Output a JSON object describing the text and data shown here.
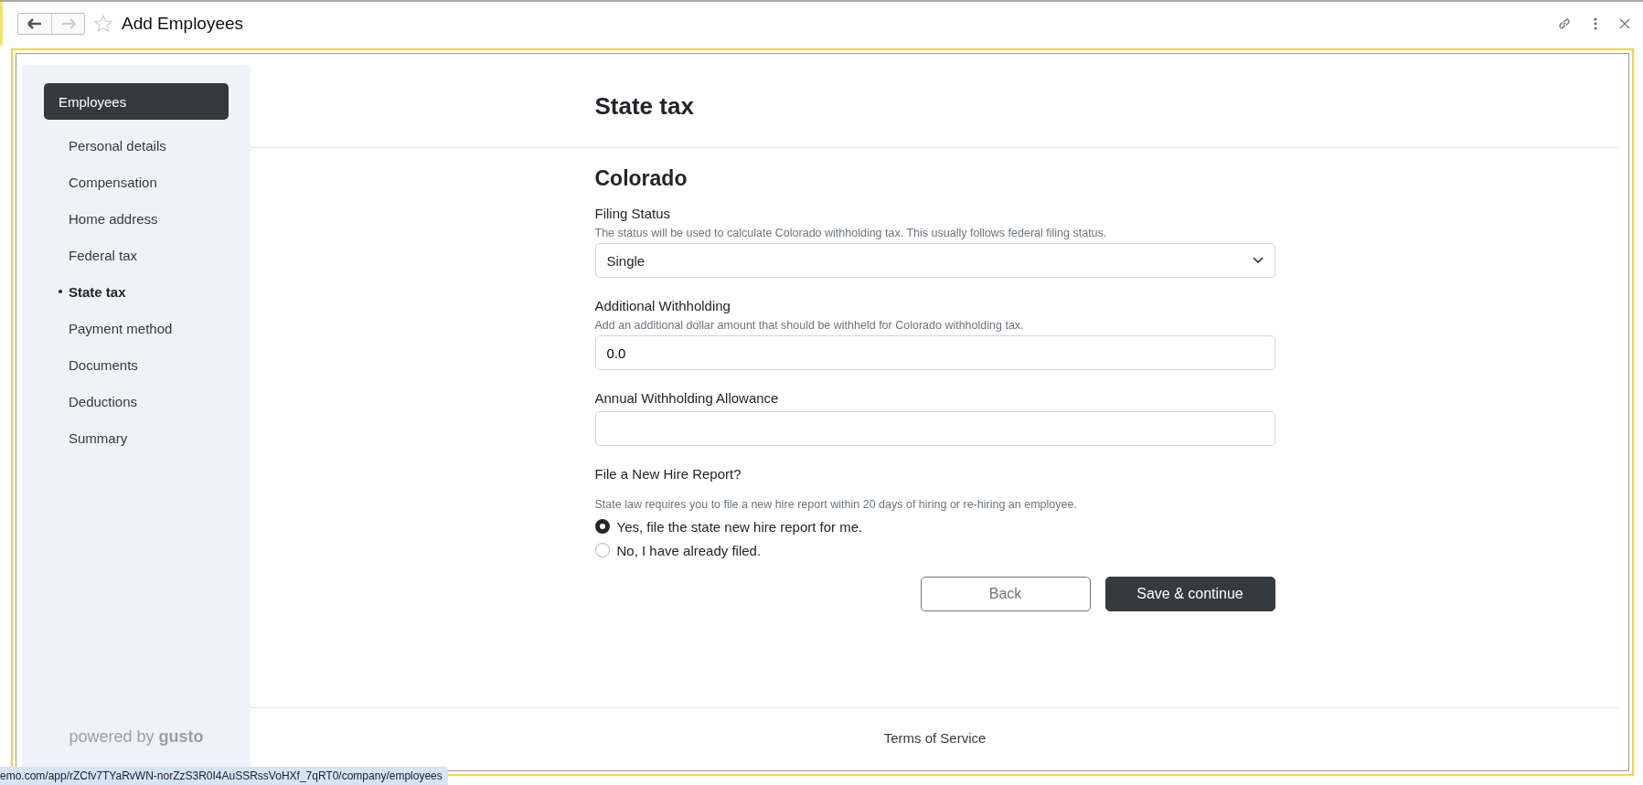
{
  "window": {
    "title": "Add Employees"
  },
  "sidebar": {
    "section": "Employees",
    "items": [
      {
        "label": "Personal details",
        "selected": false
      },
      {
        "label": "Compensation",
        "selected": false
      },
      {
        "label": "Home address",
        "selected": false
      },
      {
        "label": "Federal tax",
        "selected": false
      },
      {
        "label": "State tax",
        "selected": true
      },
      {
        "label": "Payment method",
        "selected": false
      },
      {
        "label": "Documents",
        "selected": false
      },
      {
        "label": "Deductions",
        "selected": false
      },
      {
        "label": "Summary",
        "selected": false
      }
    ],
    "footer": "powered by **gusto**"
  },
  "page": {
    "title": "State tax",
    "state": "Colorado"
  },
  "fields": [
    {
      "kind": "select",
      "label": "Filing Status",
      "hint": "The status will be used to calculate Colorado withholding tax. This usually follows federal filing status.",
      "value": "Single"
    },
    {
      "kind": "input",
      "label": "Additional Withholding",
      "hint": "Add an additional dollar amount that should be withheld for Colorado withholding tax.",
      "value": "0.0"
    },
    {
      "kind": "input",
      "label": "Annual Withholding Allowance"
    }
  ],
  "new_hire": {
    "label": "File a New Hire Report?",
    "hint": "State law requires you to file a new hire report within 20 days of hiring or re-hiring an employee.",
    "options": [
      {
        "label": "Yes, file the state new hire report for me.",
        "selected": true
      },
      {
        "label": "No, I have already filed.",
        "selected": false
      }
    ]
  },
  "buttons": {
    "back": "Back",
    "save": "Save & continue"
  },
  "footer": {
    "link": "Terms of Service"
  },
  "status_bar": {
    "url": "emo.com/app/rZCfv7TYaRvWN-norZzS3R0I4AuSSRssVoHXf_7qRT0/company/employees"
  }
}
